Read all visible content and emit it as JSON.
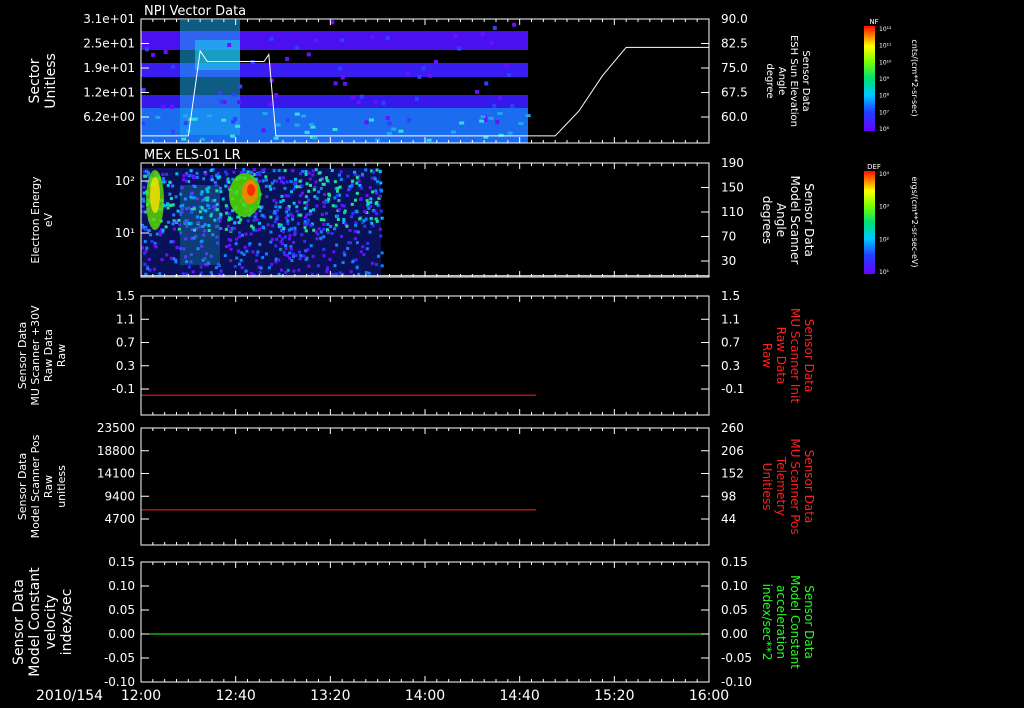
{
  "chart_data": [
    {
      "type": "heatmap",
      "title": "NPI Vector Data",
      "ylabel": [
        "Sector",
        "Unitless"
      ],
      "ylim": [
        0,
        31
      ],
      "y_ticks": [
        "3.1e+01",
        "2.5e+01",
        "1.9e+01",
        "1.2e+01",
        "6.2e+00"
      ],
      "right_ylabel": [
        "Sensor Data",
        "ESH Sun Elevation",
        "Angle",
        "degree"
      ],
      "right_ylim": [
        55,
        90
      ],
      "right_ticks": [
        "90.0",
        "82.5",
        "75.0",
        "67.5",
        "60.0"
      ],
      "colorbar": {
        "label": "NF",
        "unit": "cnts/(cm**2-sr-sec)",
        "ticks": [
          "10¹²",
          "10¹¹",
          "10¹⁰",
          "10⁹",
          "10⁸",
          "10⁷",
          "10⁶"
        ]
      },
      "line_series": {
        "color": "#ffffff",
        "x": [
          "12:00",
          "12:20",
          "12:25",
          "12:28",
          "12:52",
          "12:54",
          "12:57",
          "14:50",
          "14:55",
          "15:05",
          "15:15",
          "15:25",
          "15:30",
          "16:00"
        ],
        "y": [
          57,
          57,
          81,
          78,
          78,
          80,
          57,
          57,
          57,
          64,
          74,
          82,
          82,
          82
        ]
      }
    },
    {
      "type": "heatmap",
      "title": "MEx ELS-01 LR",
      "ylabel": [
        "Electron Energy",
        "eV"
      ],
      "y_ticks": [
        "10²",
        "10¹"
      ],
      "right_ylabel": [
        "Sensor Data",
        "Model Scanner",
        "Angle",
        "degrees"
      ],
      "right_ylim": [
        10,
        190
      ],
      "right_ticks": [
        "190",
        "150",
        "110",
        "70",
        "30"
      ],
      "colorbar": {
        "label": "DEF",
        "unit": "ergs/(cm**2-sr-sec-eV)",
        "ticks": [
          "10⁴",
          "10³",
          "10²",
          "10¹"
        ]
      },
      "line_series": {
        "color": "#ffffff",
        "x": [
          "12:00",
          "16:00"
        ],
        "y": [
          12,
          12
        ]
      }
    },
    {
      "type": "line",
      "ylabel": [
        "Sensor Data",
        "MU Scanner +30V",
        "Raw Data",
        "Raw"
      ],
      "ylim": [
        -0.3,
        1.5
      ],
      "y_ticks": [
        "1.5",
        "1.1",
        "0.7",
        "0.3",
        "-0.1"
      ],
      "right_ylabel": [
        "Sensor Data",
        "MU Scanner Init",
        "Raw Data",
        "Raw"
      ],
      "right_ticks": [
        "1.5",
        "1.1",
        "0.7",
        "0.3",
        "-0.1"
      ],
      "series": [
        {
          "color": "#ff2020",
          "x": [
            "12:00",
            "14:47"
          ],
          "y": [
            0.0,
            0.0
          ]
        }
      ]
    },
    {
      "type": "line",
      "ylabel": [
        "Sensor Data",
        "Model Scanner Pos",
        "Raw",
        "unitless"
      ],
      "ylim": [
        0,
        23500
      ],
      "y_ticks": [
        "23500",
        "18800",
        "14100",
        "9400",
        "4700"
      ],
      "right_ylabel": [
        "Sensor Data",
        "MU Scanner Pos",
        "Telemetry",
        "Unitless"
      ],
      "right_ticks": [
        "260",
        "206",
        "152",
        "98",
        "44"
      ],
      "series": [
        {
          "color": "#ff2020",
          "x": [
            "12:00",
            "14:47"
          ],
          "y": [
            7050,
            7050
          ]
        }
      ]
    },
    {
      "type": "line",
      "ylabel": [
        "Sensor Data",
        "Model Constant",
        "velocity",
        "index/sec"
      ],
      "ylim": [
        -0.1,
        0.15
      ],
      "y_ticks": [
        "0.15",
        "0.10",
        "0.05",
        "0.00",
        "-0.05",
        "-0.10"
      ],
      "right_ylabel": [
        "Sensor Data",
        "Model Constant",
        "acceleration",
        "index/sec**2"
      ],
      "right_ticks": [
        "0.15",
        "0.10",
        "0.05",
        "0.00",
        "-0.05",
        "-0.10"
      ],
      "series": [
        {
          "color": "#20ff20",
          "x": [
            "12:00",
            "16:00"
          ],
          "y": [
            0.0,
            0.0
          ]
        }
      ]
    }
  ],
  "x_axis": {
    "date": "2010/154",
    "ticks": [
      "12:00",
      "12:40",
      "13:20",
      "14:00",
      "14:40",
      "15:20",
      "16:00"
    ]
  }
}
